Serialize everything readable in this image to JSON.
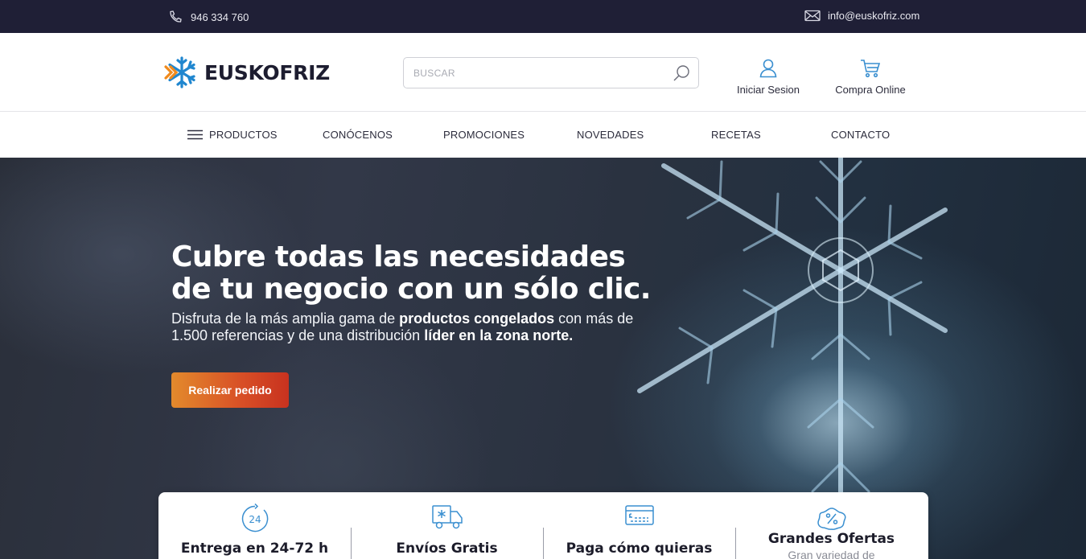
{
  "topbar": {
    "phone": "946 334 760",
    "email": "info@euskofriz.com",
    "phone_icon": "phone-icon",
    "email_icon": "envelope-icon"
  },
  "header": {
    "logo_text": "EUSKOFRIZ",
    "search_placeholder": "BUSCAR",
    "login_label": "Iniciar Sesion",
    "shop_label": "Compra Online"
  },
  "nav": {
    "items": [
      "PRODUCTOS",
      "CONÓCENOS",
      "PROMOCIONES",
      "NOVEDADES",
      "RECETAS",
      "CONTACTO"
    ]
  },
  "hero": {
    "title_line1": "Cubre todas las necesidades",
    "title_line2": "de tu negocio con un sólo clic.",
    "sub_part1": "Disfruta de la más amplia gama de ",
    "sub_bold1": "productos congelados",
    "sub_part2": " con más de 1.500 referencias y de una distribución ",
    "sub_bold2": "líder en la zona norte.",
    "cta_label": "Realizar pedido"
  },
  "features": [
    {
      "icon": "clock-24-icon",
      "title": "Entrega en 24-72 h",
      "subtitle": ""
    },
    {
      "icon": "truck-icon",
      "title": "Envíos Gratis",
      "subtitle": ""
    },
    {
      "icon": "credit-card-icon",
      "title": "Paga cómo quieras",
      "subtitle": ""
    },
    {
      "icon": "discount-tag-icon",
      "title": "Grandes Ofertas",
      "subtitle": "Gran variedad de"
    }
  ],
  "colors": {
    "topbar_bg": "#1f1f36",
    "accent_blue": "#3a8fd0",
    "cta_start": "#e38a2c",
    "cta_end": "#c8321f",
    "logo_orange": "#f08a1c",
    "logo_blue": "#1f86cf"
  }
}
